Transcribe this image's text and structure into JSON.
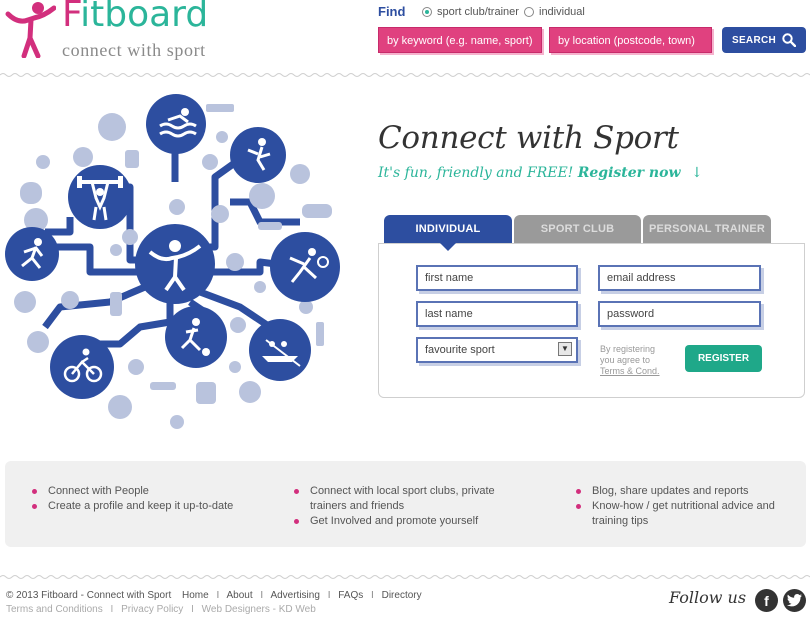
{
  "header": {
    "logo_text_f": "F",
    "logo_text_rest": "itboard",
    "tagline": "connect with sport",
    "find_label": "Find",
    "radio_options": [
      {
        "label": "sport club/trainer",
        "checked": true
      },
      {
        "label": "individual",
        "checked": false
      }
    ],
    "keyword_placeholder": "by keyword (e.g. name, sport)",
    "location_placeholder": "by location (postcode, town)",
    "search_label": "SEARCH"
  },
  "hero": {
    "headline": "Connect with Sport",
    "subline_prefix": "It's fun, friendly and FREE!",
    "subline_link": "Register now",
    "arrow": "↓"
  },
  "tabs": [
    "INDIVIDUAL",
    "SPORT CLUB",
    "PERSONAL TRAINER"
  ],
  "form": {
    "first_name": "first name",
    "email": "email address",
    "last_name": "last name",
    "password": "password",
    "favourite_sport": "favourite sport",
    "terms_line1": "By registering",
    "terms_line2": "you agree to",
    "terms_link": "Terms & Cond.",
    "register_label": "REGISTER"
  },
  "features": {
    "col1": [
      "Connect with People",
      "Create a profile and keep it up-to-date"
    ],
    "col2": [
      "Connect with local sport clubs, private trainers and friends",
      "Get Involved and promote yourself"
    ],
    "col3": [
      "Blog, share updates and reports",
      "Know-how / get nutritional advice and training tips"
    ]
  },
  "footer": {
    "copyright": "© 2013 Fitboard - Connect with Sport",
    "links": [
      "Home",
      "About",
      "Advertising",
      "FAQs",
      "Directory"
    ],
    "links2": [
      "Terms and Conditions",
      "Privacy Policy",
      "Web Designers - KD Web"
    ],
    "follow_us": "Follow us"
  },
  "colors": {
    "brand_green": "#2bb59a",
    "brand_pink": "#d22f7d",
    "brand_blue": "#2d4ea0",
    "tab_gray": "#9a9a9a",
    "icon_light": "#b9c3dd"
  },
  "icons": [
    "swimming-icon",
    "boxing-icon",
    "weightlifting-icon",
    "running-icon",
    "finish-line-runner-icon",
    "tennis-icon",
    "cycling-icon",
    "football-icon",
    "rowing-icon",
    "search-icon",
    "facebook-icon",
    "twitter-icon"
  ]
}
